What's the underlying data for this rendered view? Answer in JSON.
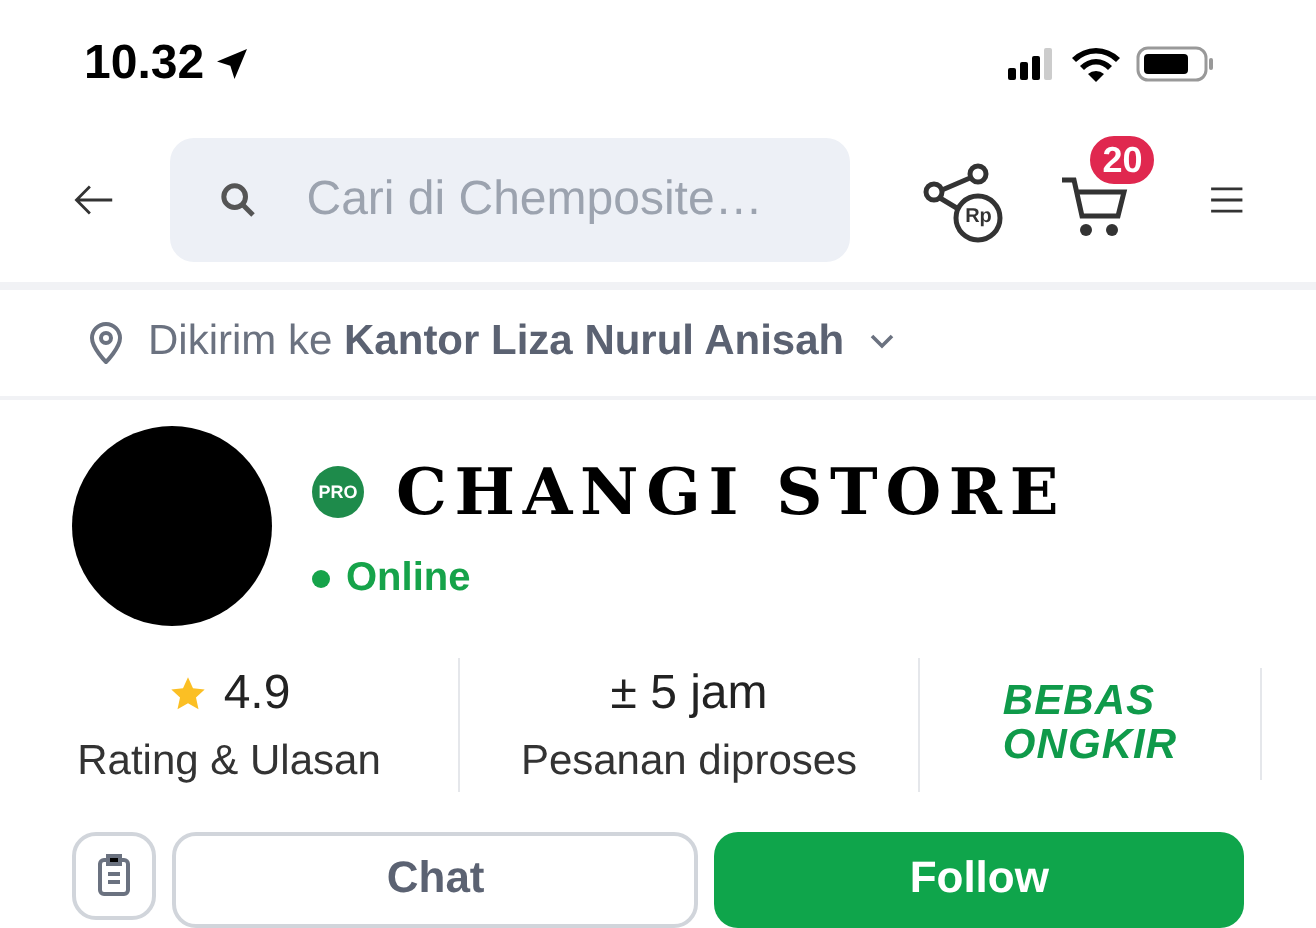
{
  "status_bar": {
    "time": "10.32"
  },
  "search": {
    "placeholder": "Cari di Chemposite…"
  },
  "share": {
    "badge": "Rp"
  },
  "cart": {
    "badge": "20"
  },
  "address": {
    "prefix": "Dikirim ke",
    "name": "Kantor Liza Nurul Anisah"
  },
  "store": {
    "badge": "PRO",
    "name": "CHANGI STORE",
    "status": "Online",
    "online": true
  },
  "stats": [
    {
      "kind": "rating",
      "value": "4.9",
      "label": "Rating & Ulasan"
    },
    {
      "kind": "text",
      "value": "± 5 jam",
      "label": "Pesanan diproses"
    },
    {
      "kind": "logo",
      "lines": [
        "BEBAS",
        "ONGKIR"
      ]
    }
  ],
  "buttons": [
    {
      "kind": "outline",
      "label": "Chat"
    },
    {
      "kind": "primary",
      "label": "Follow"
    }
  ]
}
